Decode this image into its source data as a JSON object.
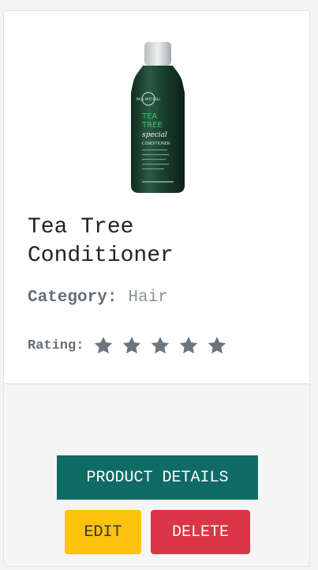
{
  "product": {
    "title": "Tea Tree Conditioner",
    "category_label": "Category:",
    "category_value": "Hair",
    "rating_label": "Rating:",
    "rating": 5,
    "rating_max": 5,
    "image_icon": "shampoo-bottle-icon",
    "bottle_text": {
      "brand": "PAUL MITCHELL",
      "line1": "TEA",
      "line2": "TREE",
      "line3": "special",
      "line4": "CONDITIONER"
    }
  },
  "actions": {
    "details_label": "PRODUCT DETAILS",
    "edit_label": "EDIT",
    "delete_label": "DELETE"
  },
  "colors": {
    "details": "#106b66",
    "edit": "#fcc20d",
    "delete": "#dc3546",
    "star": "#6c757d"
  }
}
